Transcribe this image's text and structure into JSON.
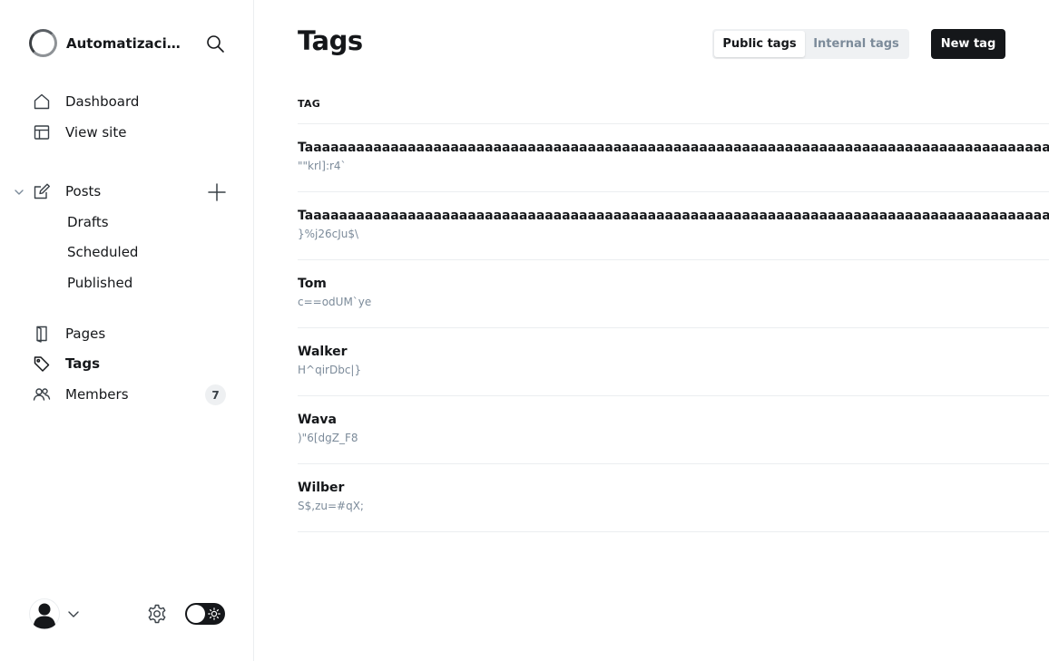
{
  "sidebar": {
    "site_name": "Automatizaciones",
    "nav": {
      "dashboard": "Dashboard",
      "view_site": "View site",
      "posts": "Posts",
      "drafts": "Drafts",
      "scheduled": "Scheduled",
      "published": "Published",
      "pages": "Pages",
      "tags": "Tags",
      "members": "Members",
      "members_count": "7"
    }
  },
  "header": {
    "title": "Tags",
    "tabs": [
      "Public tags",
      "Internal tags"
    ],
    "active_tab": "Public tags",
    "new_tag_label": "New tag"
  },
  "table": {
    "column_header": "TAG",
    "rows": [
      {
        "name": "Taaaaaaaaaaaaaaaaaaaaaaaaaaaaaaaaaaaaaaaaaaaaaaaaaaaaaaaaaaaaaaaaaaaaaaaaaaaaaaaaaaaaaaaaaaaaaa",
        "slug": "\"\"krl]:r4`"
      },
      {
        "name": "Taaaaaaaaaaaaaaaaaaaaaaaaaaaaaaaaaaaaaaaaaaaaaaaaaaaaaaaaaaaaaaaaaaaaaaaaaaaaaaaaaaaaaaaaaaaaaa",
        "slug": "}%j26cJu$\\"
      },
      {
        "name": "Tom",
        "slug": "c==odUM`ye"
      },
      {
        "name": "Walker",
        "slug": "H^qirDbc|}"
      },
      {
        "name": "Wava",
        "slug": ")\"6[dgZ_F8"
      },
      {
        "name": "Wilber",
        "slug": "S$,zu=#qX;"
      }
    ]
  },
  "colors": {
    "text": "#15171a",
    "muted": "#7c8b9a",
    "border": "#ebeef0",
    "button_bg": "#15171a"
  },
  "icons": [
    "search-icon",
    "home-icon",
    "layout-icon",
    "edit-icon",
    "plus-icon",
    "chevron-down-icon",
    "page-icon",
    "tag-icon",
    "members-icon",
    "settings-icon",
    "sun-icon",
    "avatar-icon"
  ]
}
